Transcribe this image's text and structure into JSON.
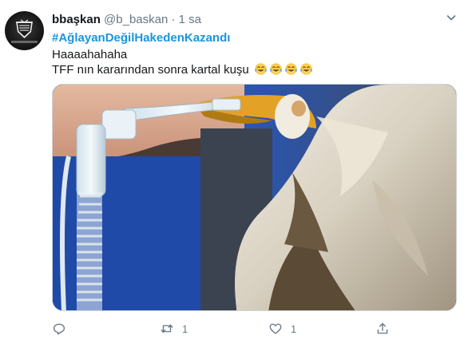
{
  "tweet": {
    "display_name": "bbaşkan",
    "handle": "@b_baskan",
    "separator": "·",
    "time": "1 sa",
    "hashtag": "#AğlayanDeğilHakedenKazandı",
    "line1": "Haaaahahaha",
    "line2": "TFF nın kararından sonra kartal kuşu",
    "emoji": [
      "face-with-tears-of-joy",
      "face-with-tears-of-joy",
      "face-with-tears-of-joy",
      "face-with-tears-of-joy"
    ],
    "media_subject": "eagle receiving treatment with breathing tube",
    "actions": {
      "reply_count": "",
      "retweet_count": "1",
      "like_count": "1",
      "share_count": ""
    }
  },
  "colors": {
    "link": "#1b95e0",
    "secondary_text": "#657786",
    "primary_text": "#14171a",
    "emoji_yellow": "#ffcc4d",
    "emoji_tear": "#5dadec"
  },
  "icons": [
    "caret-down-icon",
    "reply-icon",
    "retweet-icon",
    "like-icon",
    "share-icon"
  ]
}
